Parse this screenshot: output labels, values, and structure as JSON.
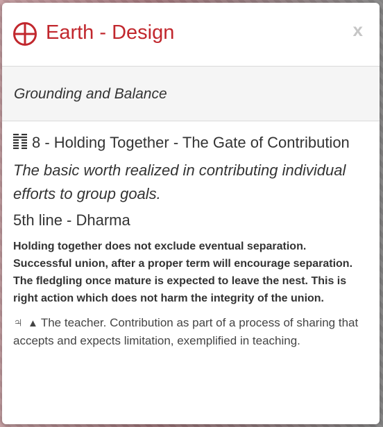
{
  "header": {
    "title": "Earth - Design",
    "close_label": "x",
    "accent_color": "#c1272d"
  },
  "subheader": {
    "text": "Grounding and Balance"
  },
  "gate": {
    "icon": "hexagram-icon",
    "heading": "8 - Holding Together - The Gate of Contribution",
    "summary": "The basic worth realized in contributing individual efforts to group goals."
  },
  "line": {
    "heading": "5th line - Dharma",
    "text": "Holding together does not exclude eventual separation. Successful union, after a proper term will encourage separation. The fledgling once mature is expected to leave the nest. This is right action which does not harm the integrity of the union."
  },
  "exaltation": {
    "planet_symbol": "♃",
    "planet_icon": "jupiter-icon",
    "direction_symbol": "▲",
    "direction_icon": "up-triangle-icon",
    "text": "The teacher. Contribution as part of a process of sharing that accepts and expects limitation, exemplified in teaching."
  }
}
